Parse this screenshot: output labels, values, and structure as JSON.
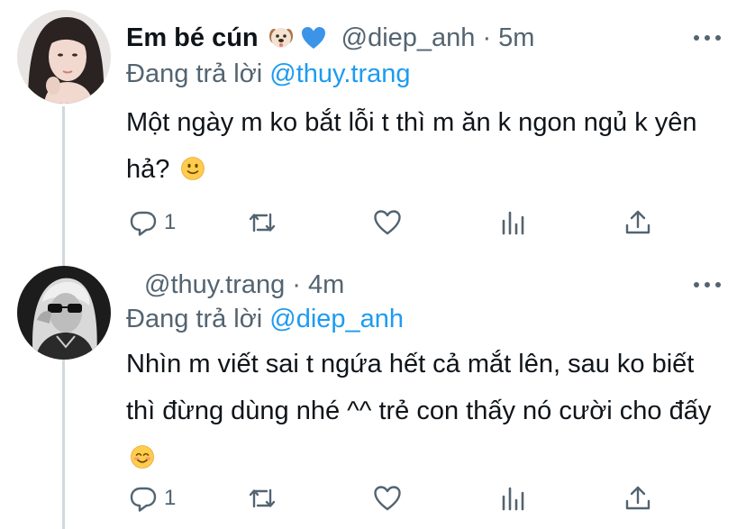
{
  "tweets": [
    {
      "display_name": "Em bé cún",
      "name_emojis": [
        "dog-face-icon",
        "blue-heart-icon"
      ],
      "handle": "@diep_anh",
      "time": "5m",
      "reply_prefix": "Đang trả lời",
      "reply_mention": "@thuy.trang",
      "text": "Một ngày m ko bắt lỗi t thì m ăn k ngon ngủ k yên hả?",
      "text_emoji": "slightly-smiling-face-icon",
      "reply_count": "1",
      "retweet_count": "",
      "like_count": ""
    },
    {
      "display_name": "",
      "handle": "@thuy.trang",
      "time": "4m",
      "reply_prefix": "Đang trả lời",
      "reply_mention": "@diep_anh",
      "text": "Nhìn m viết sai t ngứa hết cả mắt lên, sau ko biết thì đừng dùng nhé ^^ trẻ con thấy nó cười cho đấy",
      "text_emoji": "smiling-face-with-smiling-eyes-icon",
      "reply_count": "1",
      "retweet_count": "",
      "like_count": ""
    }
  ],
  "colors": {
    "text": "#0f1419",
    "secondary": "#536471",
    "accent": "#1d9bf0",
    "thread_line": "#cfd9de"
  }
}
